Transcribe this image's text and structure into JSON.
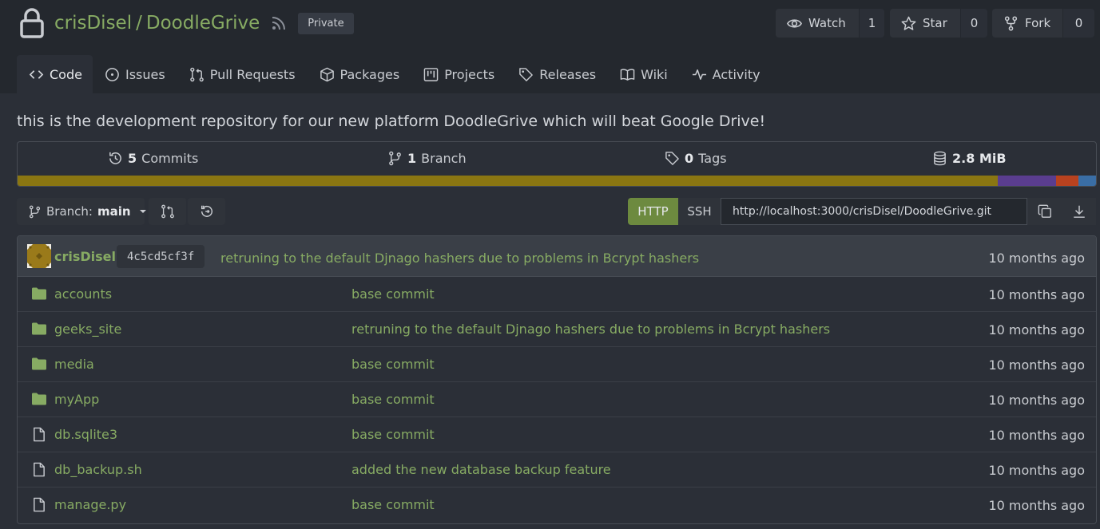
{
  "repo": {
    "owner": "crisDisel",
    "separator": "/",
    "name": "DoodleGrive",
    "visibility": "Private",
    "description": "this is the development repository for our new platform DoodleGrive which will beat Google Drive!"
  },
  "actions": {
    "watch": {
      "label": "Watch",
      "count": "1"
    },
    "star": {
      "label": "Star",
      "count": "0"
    },
    "fork": {
      "label": "Fork",
      "count": "0"
    }
  },
  "tabs": [
    {
      "label": "Code",
      "icon": "code-icon",
      "active": true
    },
    {
      "label": "Issues",
      "icon": "issue-icon"
    },
    {
      "label": "Pull Requests",
      "icon": "pull-request-icon"
    },
    {
      "label": "Packages",
      "icon": "package-icon"
    },
    {
      "label": "Projects",
      "icon": "project-icon"
    },
    {
      "label": "Releases",
      "icon": "tag-icon"
    },
    {
      "label": "Wiki",
      "icon": "book-icon"
    },
    {
      "label": "Activity",
      "icon": "pulse-icon"
    }
  ],
  "stats": {
    "commits": {
      "count": "5",
      "label": "Commits"
    },
    "branches": {
      "count": "1",
      "label": "Branch"
    },
    "tags": {
      "count": "0",
      "label": "Tags"
    },
    "size": {
      "value": "2.8 MiB"
    }
  },
  "language_bar": [
    {
      "color": "#8a7612",
      "fraction": 0.909
    },
    {
      "color": "#5a3d8f",
      "fraction": 0.054
    },
    {
      "color": "#b8421f",
      "fraction": 0.021
    },
    {
      "color": "#3a6ea5",
      "fraction": 0.016
    }
  ],
  "toolbar": {
    "branch_prefix": "Branch:",
    "branch_name": "main",
    "protocol_http": "HTTP",
    "protocol_ssh": "SSH",
    "clone_url": "http://localhost:3000/crisDisel/DoodleGrive.git"
  },
  "latest_commit": {
    "author": "crisDisel",
    "sha": "4c5cd5cf3f",
    "message": "retruning to the default Djnago hashers due to problems in Bcrypt hashers",
    "time": "10 months ago"
  },
  "files": [
    {
      "name": "accounts",
      "type": "folder",
      "message": "base commit",
      "time": "10 months ago"
    },
    {
      "name": "geeks_site",
      "type": "folder",
      "message": "retruning to the default Djnago hashers due to problems in Bcrypt hashers",
      "time": "10 months ago"
    },
    {
      "name": "media",
      "type": "folder",
      "message": "base commit",
      "time": "10 months ago"
    },
    {
      "name": "myApp",
      "type": "folder",
      "message": "base commit",
      "time": "10 months ago"
    },
    {
      "name": "db.sqlite3",
      "type": "file",
      "message": "base commit",
      "time": "10 months ago"
    },
    {
      "name": "db_backup.sh",
      "type": "file",
      "message": "added the new database backup feature",
      "time": "10 months ago"
    },
    {
      "name": "manage.py",
      "type": "file",
      "message": "base commit",
      "time": "10 months ago"
    }
  ],
  "colors": {
    "accent": "#87ab63",
    "header_bg": "#24282e",
    "body_bg": "#2b2f37",
    "http_active": "#6d8a3f"
  }
}
